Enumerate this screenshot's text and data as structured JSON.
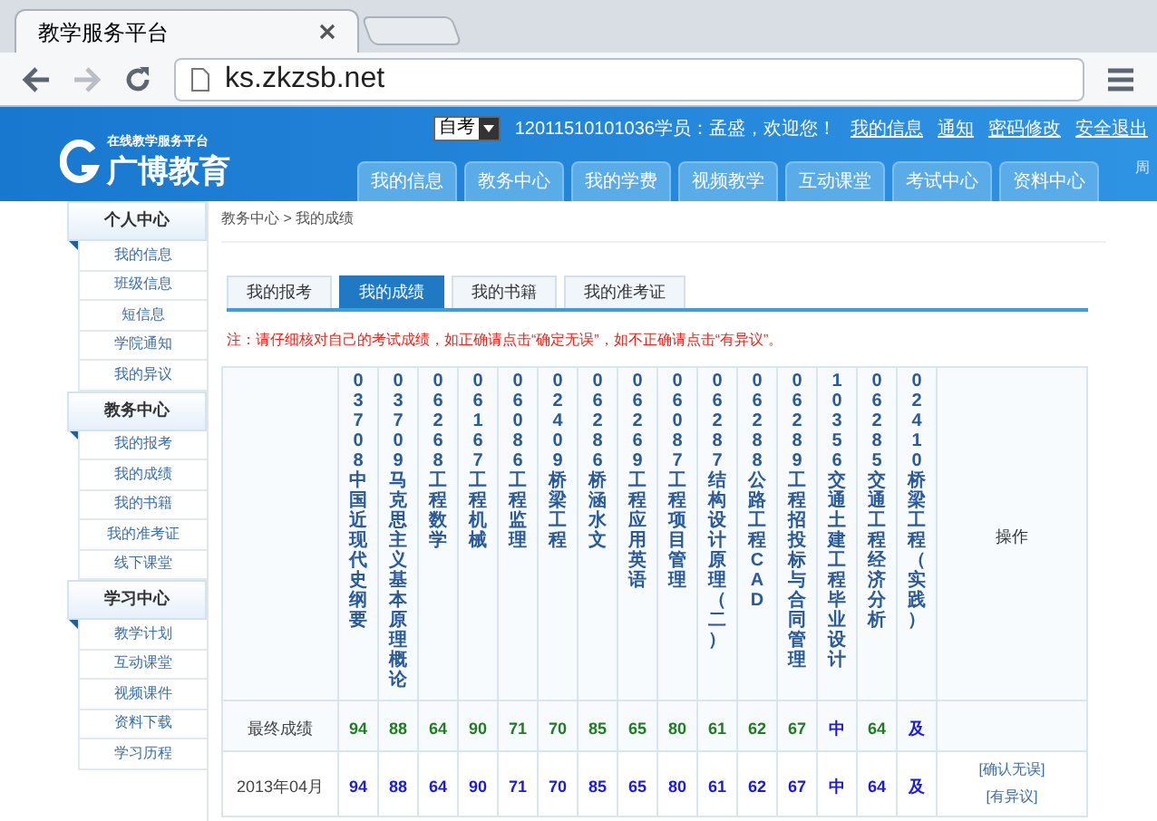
{
  "browser": {
    "tab_title": "教学服务平台",
    "address": "ks.zkzsb.net"
  },
  "header": {
    "logo_tagline": "在线教学服务平台",
    "logo_name": "广博教育",
    "exam_type": "自考",
    "welcome": "12011510101036学员：孟盛，欢迎您！",
    "links": [
      "我的信息",
      "通知",
      "密码修改",
      "安全退出"
    ],
    "side_text": "周",
    "nav": [
      "我的信息",
      "教务中心",
      "我的学费",
      "视频教学",
      "互动课堂",
      "考试中心",
      "资料中心"
    ]
  },
  "sidebar": [
    {
      "title": "个人中心",
      "items": [
        "我的信息",
        "班级信息",
        "短信息",
        "学院通知",
        "我的异议"
      ]
    },
    {
      "title": "教务中心",
      "items": [
        "我的报考",
        "我的成绩",
        "我的书籍",
        "我的准考证",
        "线下课堂"
      ]
    },
    {
      "title": "学习中心",
      "items": [
        "教学计划",
        "互动课堂",
        "视频课件",
        "资料下载",
        "学习历程"
      ]
    }
  ],
  "breadcrumb": "教务中心 > 我的成绩",
  "tabs": [
    {
      "label": "我的报考",
      "selected": false
    },
    {
      "label": "我的成绩",
      "selected": true
    },
    {
      "label": "我的书籍",
      "selected": false
    },
    {
      "label": "我的准考证",
      "selected": false
    }
  ],
  "notice": "注：请仔细核对自己的考试成绩，如正确请点击“确定无误”，如不正确请点击“有异议”。",
  "table": {
    "columns": [
      "03708中国近现代史纲要",
      "03709马克思主义基本原理概论",
      "06268工程数学",
      "06167工程机械",
      "06086工程监理",
      "02409桥梁工程",
      "06286桥涵水文",
      "06269工程应用英语",
      "06087工程项目管理",
      "06287结构设计原理（二）",
      "06288公路工程CAD",
      "06289工程招投标与合同管理",
      "10356交通土建工程毕业设计",
      "06285交通工程经济分析",
      "02410桥梁工程（实践）"
    ],
    "action_column": "操作",
    "rows": [
      {
        "label": "最终成绩",
        "scores": [
          {
            "value": "94",
            "color": "#1e7d1e"
          },
          {
            "value": "88",
            "color": "#1e7d1e"
          },
          {
            "value": "64",
            "color": "#1e7d1e"
          },
          {
            "value": "90",
            "color": "#1e7d1e"
          },
          {
            "value": "71",
            "color": "#1e7d1e"
          },
          {
            "value": "70",
            "color": "#1e7d1e"
          },
          {
            "value": "85",
            "color": "#1e7d1e"
          },
          {
            "value": "65",
            "color": "#1e7d1e"
          },
          {
            "value": "80",
            "color": "#1e7d1e"
          },
          {
            "value": "61",
            "color": "#1e7d1e"
          },
          {
            "value": "62",
            "color": "#1e7d1e"
          },
          {
            "value": "67",
            "color": "#1e7d1e"
          },
          {
            "value": "中",
            "color": "#1a1ae0"
          },
          {
            "value": "64",
            "color": "#1e7d1e"
          },
          {
            "value": "及",
            "color": "#1a1ae0"
          }
        ],
        "actions": []
      },
      {
        "label": "2013年04月",
        "scores": [
          {
            "value": "94",
            "color": "#1a1ae0"
          },
          {
            "value": "88",
            "color": "#1a1ae0"
          },
          {
            "value": "64",
            "color": "#1a1ae0"
          },
          {
            "value": "90",
            "color": "#1a1ae0"
          },
          {
            "value": "71",
            "color": "#1a1ae0"
          },
          {
            "value": "70",
            "color": "#1a1ae0"
          },
          {
            "value": "85",
            "color": "#1a1ae0"
          },
          {
            "value": "65",
            "color": "#1a1ae0"
          },
          {
            "value": "80",
            "color": "#1a1ae0"
          },
          {
            "value": "61",
            "color": "#1a1ae0"
          },
          {
            "value": "62",
            "color": "#1a1ae0"
          },
          {
            "value": "67",
            "color": "#1a1ae0"
          },
          {
            "value": "中",
            "color": "#1a1ae0"
          },
          {
            "value": "64",
            "color": "#1a1ae0"
          },
          {
            "value": "及",
            "color": "#1a1ae0"
          }
        ],
        "actions": [
          "[确认无误]",
          "[有异议]"
        ]
      }
    ]
  }
}
